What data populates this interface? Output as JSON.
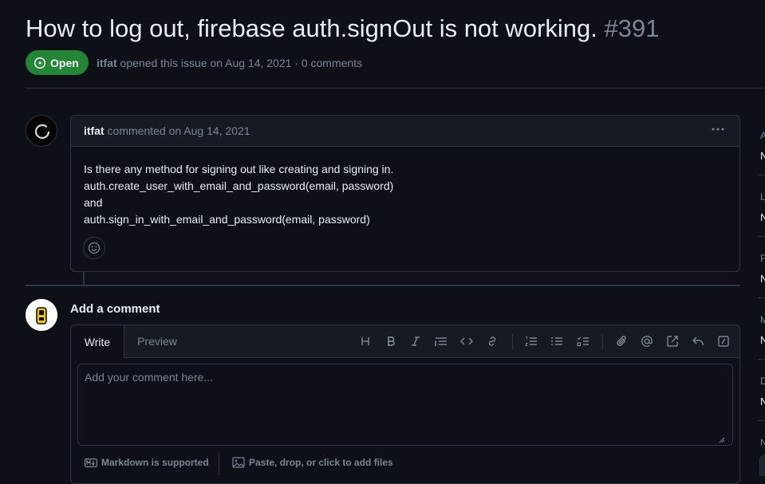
{
  "issue": {
    "title": "How to log out, firebase auth.signOut is not working.",
    "number": "#391",
    "state": "Open",
    "state_color": "#238636",
    "author": "itfat",
    "meta_text": " opened this issue on Aug 14, 2021 · 0 comments"
  },
  "comment": {
    "author": "itfat",
    "meta_text": " commented on Aug 14, 2021",
    "menu_icon": "kebab-horizontal-icon",
    "body": [
      "Is there any method for signing out like creating and signing in.",
      "auth.create_user_with_email_and_password(email, password)",
      "and",
      "auth.sign_in_with_email_and_password(email, password)"
    ],
    "reaction_icon": "smiley-icon"
  },
  "new_comment": {
    "heading": "Add a comment",
    "tabs": [
      "Write",
      "Preview"
    ],
    "placeholder": "Add your comment here...",
    "toolbar_icons": [
      "heading-icon",
      "bold-icon",
      "italic-icon",
      "quote-icon",
      "code-icon",
      "link-icon",
      "ordered-list-icon",
      "unordered-list-icon",
      "task-list-icon",
      "attach-icon",
      "mention-icon",
      "reference-icon",
      "reply-icon",
      "slash-command-icon"
    ],
    "markdown_note": "Markdown is supported",
    "attach_note": "Paste, drop, or click to add files"
  },
  "sidebar": {
    "letters": [
      "A",
      "N",
      "L",
      "N",
      "P",
      "N",
      "M",
      "N",
      "D",
      "N",
      "N"
    ]
  },
  "colors": {
    "background": "#0d1117",
    "panel": "#161b22",
    "border": "#30363d",
    "muted": "#7d8590",
    "text": "#e6edf3"
  }
}
